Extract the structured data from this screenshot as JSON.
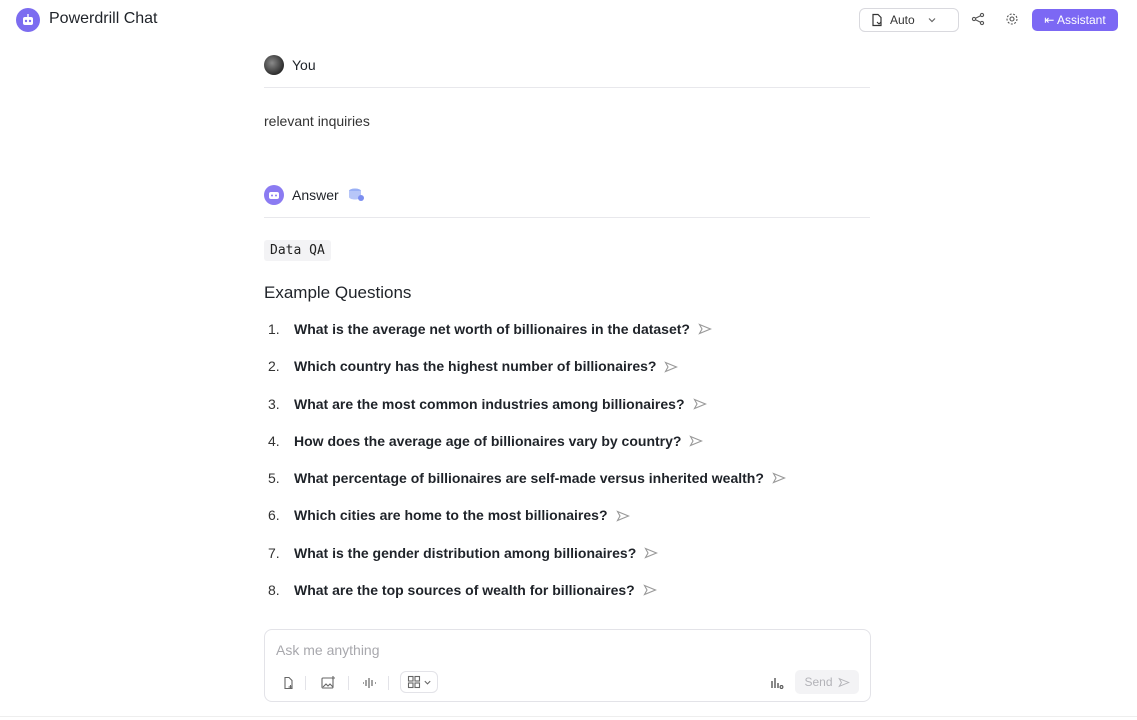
{
  "app": {
    "title": "Powerdrill Chat"
  },
  "header": {
    "mode_label": "Auto",
    "assistant_label": "⇤ Assistant"
  },
  "user_message": {
    "author": "You",
    "text": "relevant inquiries"
  },
  "answer": {
    "author": "Answer",
    "tag": "Data QA",
    "section_title": "Example Questions",
    "questions": [
      {
        "num": "1.",
        "text": "What is the average net worth of billionaires in the dataset?"
      },
      {
        "num": "2.",
        "text": "Which country has the highest number of billionaires?"
      },
      {
        "num": "3.",
        "text": "What are the most common industries among billionaires?"
      },
      {
        "num": "4.",
        "text": "How does the average age of billionaires vary by country?"
      },
      {
        "num": "5.",
        "text": "What percentage of billionaires are self-made versus inherited wealth?"
      },
      {
        "num": "6.",
        "text": "Which cities are home to the most billionaires?"
      },
      {
        "num": "7.",
        "text": "What is the gender distribution among billionaires?"
      },
      {
        "num": "8.",
        "text": "What are the top sources of wealth for billionaires?"
      }
    ]
  },
  "composer": {
    "placeholder": "Ask me anything",
    "send_label": "Send"
  },
  "colors": {
    "accent": "#7c68f4",
    "divider": "#e8e8ec"
  },
  "icons": [
    "robot-logo-icon",
    "file-icon",
    "chevron-down-icon",
    "share-icon",
    "gear-icon",
    "arrow-left-bar-icon",
    "user-avatar",
    "bot-avatar",
    "database-icon",
    "send-arrow-icon",
    "attach-file-icon",
    "image-icon",
    "voice-icon",
    "grid-icon",
    "chart-icon"
  ]
}
